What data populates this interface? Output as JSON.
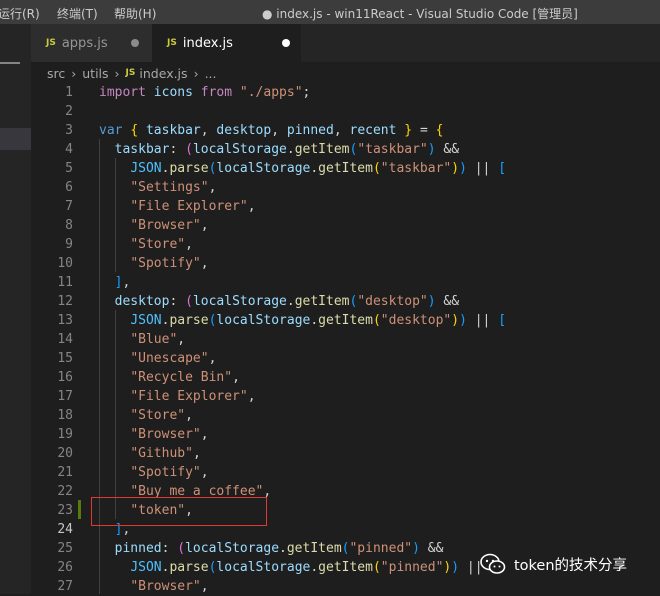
{
  "titlebar": {
    "menu": [
      "运行(R)",
      "终端(T)",
      "帮助(H)"
    ],
    "title": "● index.js - win11React - Visual Studio Code [管理员]"
  },
  "tabs": [
    {
      "icon": "JS",
      "label": "apps.js",
      "active": false,
      "modified": true
    },
    {
      "icon": "JS",
      "label": "index.js",
      "active": true,
      "modified": true
    }
  ],
  "breadcrumb": {
    "items": [
      "src",
      "utils"
    ],
    "file_icon": "JS",
    "file": "index.js",
    "more": "..."
  },
  "editor": {
    "current_line": 24,
    "lines": [
      {
        "n": "1",
        "tokens": [
          [
            "kw2",
            "import"
          ],
          [
            "p",
            " "
          ],
          [
            "var",
            "icons"
          ],
          [
            "p",
            " "
          ],
          [
            "kw2",
            "from"
          ],
          [
            "p",
            " "
          ],
          [
            "str",
            "\"./apps\""
          ],
          [
            "p",
            ";"
          ]
        ]
      },
      {
        "n": "2",
        "tokens": []
      },
      {
        "n": "3",
        "tokens": [
          [
            "kw",
            "var"
          ],
          [
            "p",
            " "
          ],
          [
            "b1",
            "{"
          ],
          [
            "p",
            " "
          ],
          [
            "var",
            "taskbar"
          ],
          [
            "p",
            ", "
          ],
          [
            "var",
            "desktop"
          ],
          [
            "p",
            ", "
          ],
          [
            "var",
            "pinned"
          ],
          [
            "p",
            ", "
          ],
          [
            "var",
            "recent"
          ],
          [
            "p",
            " "
          ],
          [
            "b1",
            "}"
          ],
          [
            "p",
            " = "
          ],
          [
            "b1",
            "{"
          ]
        ]
      },
      {
        "n": "4",
        "tokens": [
          [
            "p",
            "  "
          ],
          [
            "var",
            "taskbar"
          ],
          [
            "p",
            ": "
          ],
          [
            "b2",
            "("
          ],
          [
            "var",
            "localStorage"
          ],
          [
            "p",
            "."
          ],
          [
            "fn",
            "getItem"
          ],
          [
            "b3",
            "("
          ],
          [
            "str",
            "\"taskbar\""
          ],
          [
            "b3",
            ")"
          ],
          [
            "p",
            " &&"
          ]
        ]
      },
      {
        "n": "5",
        "tokens": [
          [
            "p",
            "    "
          ],
          [
            "const",
            "JSON"
          ],
          [
            "p",
            "."
          ],
          [
            "fn",
            "parse"
          ],
          [
            "b3",
            "("
          ],
          [
            "var",
            "localStorage"
          ],
          [
            "p",
            "."
          ],
          [
            "fn",
            "getItem"
          ],
          [
            "b1",
            "("
          ],
          [
            "str",
            "\"taskbar\""
          ],
          [
            "b1",
            ")"
          ],
          [
            "b3",
            ")"
          ],
          [
            "p",
            " || "
          ],
          [
            "b3",
            "["
          ]
        ]
      },
      {
        "n": "6",
        "tokens": [
          [
            "p",
            "    "
          ],
          [
            "str",
            "\"Settings\""
          ],
          [
            "p",
            ","
          ]
        ]
      },
      {
        "n": "7",
        "tokens": [
          [
            "p",
            "    "
          ],
          [
            "str",
            "\"File Explorer\""
          ],
          [
            "p",
            ","
          ]
        ]
      },
      {
        "n": "8",
        "tokens": [
          [
            "p",
            "    "
          ],
          [
            "str",
            "\"Browser\""
          ],
          [
            "p",
            ","
          ]
        ]
      },
      {
        "n": "9",
        "tokens": [
          [
            "p",
            "    "
          ],
          [
            "str",
            "\"Store\""
          ],
          [
            "p",
            ","
          ]
        ]
      },
      {
        "n": "10",
        "tokens": [
          [
            "p",
            "    "
          ],
          [
            "str",
            "\"Spotify\""
          ],
          [
            "p",
            ","
          ]
        ]
      },
      {
        "n": "11",
        "tokens": [
          [
            "p",
            "  "
          ],
          [
            "b3",
            "]"
          ],
          [
            "p",
            ","
          ]
        ]
      },
      {
        "n": "12",
        "tokens": [
          [
            "p",
            "  "
          ],
          [
            "var",
            "desktop"
          ],
          [
            "p",
            ": "
          ],
          [
            "b2",
            "("
          ],
          [
            "var",
            "localStorage"
          ],
          [
            "p",
            "."
          ],
          [
            "fn",
            "getItem"
          ],
          [
            "b3",
            "("
          ],
          [
            "str",
            "\"desktop\""
          ],
          [
            "b3",
            ")"
          ],
          [
            "p",
            " &&"
          ]
        ]
      },
      {
        "n": "13",
        "tokens": [
          [
            "p",
            "    "
          ],
          [
            "const",
            "JSON"
          ],
          [
            "p",
            "."
          ],
          [
            "fn",
            "parse"
          ],
          [
            "b3",
            "("
          ],
          [
            "var",
            "localStorage"
          ],
          [
            "p",
            "."
          ],
          [
            "fn",
            "getItem"
          ],
          [
            "b1",
            "("
          ],
          [
            "str",
            "\"desktop\""
          ],
          [
            "b1",
            ")"
          ],
          [
            "b3",
            ")"
          ],
          [
            "p",
            " || "
          ],
          [
            "b3",
            "["
          ]
        ]
      },
      {
        "n": "14",
        "tokens": [
          [
            "p",
            "    "
          ],
          [
            "str",
            "\"Blue\""
          ],
          [
            "p",
            ","
          ]
        ]
      },
      {
        "n": "15",
        "tokens": [
          [
            "p",
            "    "
          ],
          [
            "str",
            "\"Unescape\""
          ],
          [
            "p",
            ","
          ]
        ]
      },
      {
        "n": "16",
        "tokens": [
          [
            "p",
            "    "
          ],
          [
            "str",
            "\"Recycle Bin\""
          ],
          [
            "p",
            ","
          ]
        ]
      },
      {
        "n": "17",
        "tokens": [
          [
            "p",
            "    "
          ],
          [
            "str",
            "\"File Explorer\""
          ],
          [
            "p",
            ","
          ]
        ]
      },
      {
        "n": "18",
        "tokens": [
          [
            "p",
            "    "
          ],
          [
            "str",
            "\"Store\""
          ],
          [
            "p",
            ","
          ]
        ]
      },
      {
        "n": "19",
        "tokens": [
          [
            "p",
            "    "
          ],
          [
            "str",
            "\"Browser\""
          ],
          [
            "p",
            ","
          ]
        ]
      },
      {
        "n": "20",
        "tokens": [
          [
            "p",
            "    "
          ],
          [
            "str",
            "\"Github\""
          ],
          [
            "p",
            ","
          ]
        ]
      },
      {
        "n": "21",
        "tokens": [
          [
            "p",
            "    "
          ],
          [
            "str",
            "\"Spotify\""
          ],
          [
            "p",
            ","
          ]
        ]
      },
      {
        "n": "22",
        "tokens": [
          [
            "p",
            "    "
          ],
          [
            "str",
            "\"Buy me a coffee\""
          ],
          [
            "p",
            ","
          ]
        ]
      },
      {
        "n": "23",
        "tokens": [
          [
            "p",
            "    "
          ],
          [
            "str",
            "\"token\""
          ],
          [
            "p",
            ","
          ]
        ]
      },
      {
        "n": "24",
        "tokens": [
          [
            "p",
            "  "
          ],
          [
            "b3",
            "]"
          ],
          [
            "p",
            ","
          ]
        ]
      },
      {
        "n": "25",
        "tokens": [
          [
            "p",
            "  "
          ],
          [
            "var",
            "pinned"
          ],
          [
            "p",
            ": "
          ],
          [
            "b2",
            "("
          ],
          [
            "var",
            "localStorage"
          ],
          [
            "p",
            "."
          ],
          [
            "fn",
            "getItem"
          ],
          [
            "b3",
            "("
          ],
          [
            "str",
            "\"pinned\""
          ],
          [
            "b3",
            ")"
          ],
          [
            "p",
            " &&"
          ]
        ]
      },
      {
        "n": "26",
        "tokens": [
          [
            "p",
            "    "
          ],
          [
            "const",
            "JSON"
          ],
          [
            "p",
            "."
          ],
          [
            "fn",
            "parse"
          ],
          [
            "b3",
            "("
          ],
          [
            "var",
            "localStorage"
          ],
          [
            "p",
            "."
          ],
          [
            "fn",
            "getItem"
          ],
          [
            "b1",
            "("
          ],
          [
            "str",
            "\"pinned\""
          ],
          [
            "b1",
            ")"
          ],
          [
            "b3",
            ")"
          ],
          [
            "p",
            " || "
          ],
          [
            "b3",
            "["
          ]
        ]
      },
      {
        "n": "27",
        "tokens": [
          [
            "p",
            "    "
          ],
          [
            "str",
            "\"Browser\""
          ],
          [
            "p",
            ","
          ]
        ]
      }
    ]
  },
  "watermark": {
    "text": "token的技术分享",
    "icon": "wechat-icon"
  },
  "colors": {
    "background": "#1e1e1e",
    "keyword": "#569cd6",
    "control_keyword": "#c586c0",
    "variable": "#9cdcfe",
    "string": "#ce9178",
    "function": "#dcdcaa",
    "constant": "#4fc1ff",
    "highlight_box": "#e0392f",
    "gutter_added": "#587c0c"
  }
}
